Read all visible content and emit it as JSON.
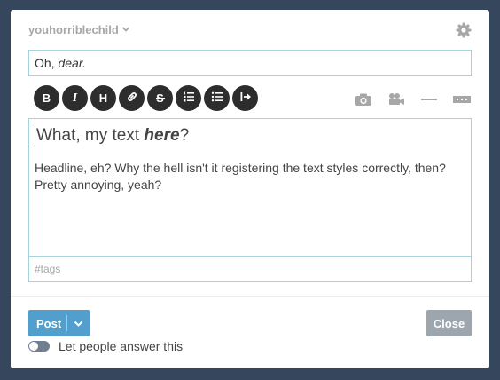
{
  "header": {
    "blog_name": "youhorriblechild",
    "blog_dropdown_icon": "chevron-down-icon",
    "settings_icon": "gear-icon"
  },
  "title_field": {
    "prefix": "Oh,",
    "italic": "dear."
  },
  "toolbar": {
    "buttons": [
      {
        "label": "B",
        "name": "bold"
      },
      {
        "label": "I",
        "name": "italic"
      },
      {
        "label": "H",
        "name": "heading"
      },
      {
        "icon": "link-icon",
        "name": "link"
      },
      {
        "label": "S",
        "name": "strikethrough"
      },
      {
        "icon": "ordered-list-icon",
        "name": "ordered-list"
      },
      {
        "icon": "unordered-list-icon",
        "name": "unordered-list"
      },
      {
        "icon": "indent-icon",
        "name": "indent"
      }
    ],
    "media": [
      "camera-icon",
      "video-icon",
      "horizontal-rule-icon",
      "read-more-icon"
    ]
  },
  "editor": {
    "headline_prefix": "What, my text ",
    "headline_emphasis": "here",
    "headline_suffix": "?",
    "body": "Headline, eh? Why the hell isn't it registering the text styles correctly, then? Pretty annoying, yeah?",
    "tags_placeholder": "#tags"
  },
  "footer": {
    "post_label": "Post",
    "close_label": "Close",
    "answers_label": "Let people answer this",
    "answers_enabled": false,
    "colors": {
      "post": "#529ecc",
      "close": "#9da6af",
      "background": "#36465d"
    }
  }
}
